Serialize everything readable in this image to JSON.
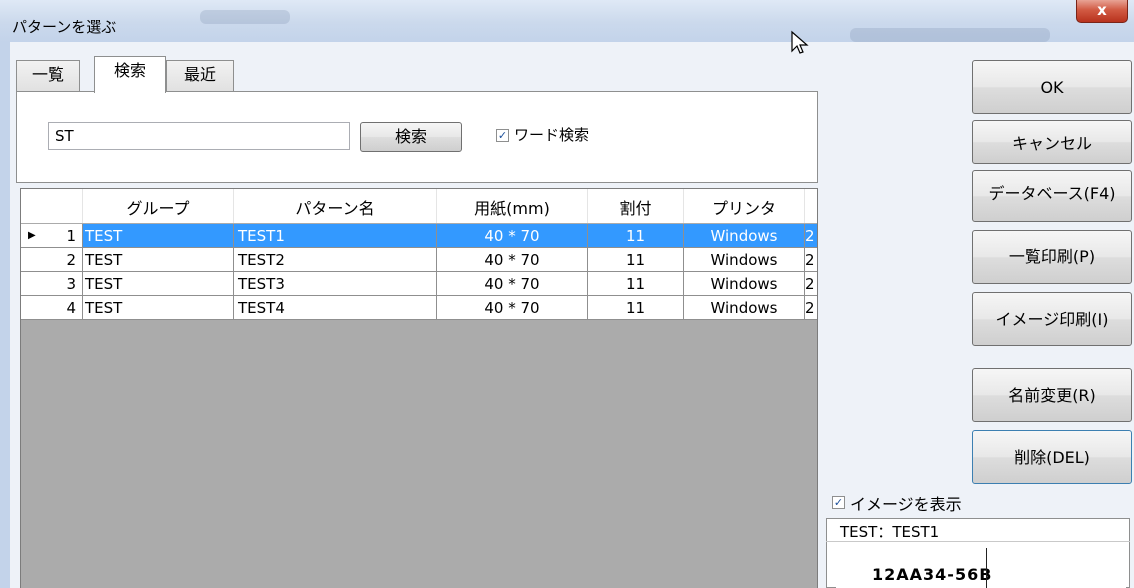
{
  "window": {
    "title": "パターンを選ぶ",
    "close_label": "x"
  },
  "tabs": [
    "一覧",
    "検索",
    "最近"
  ],
  "search": {
    "value": "ST",
    "button_label": "検索",
    "word_search_label": "ワード検索",
    "word_search_checked": true
  },
  "grid": {
    "columns": [
      "グループ",
      "パターン名",
      "用紙(mm)",
      "割付",
      "プリンタ"
    ],
    "rows": [
      {
        "num": "1",
        "group": "TEST",
        "name": "TEST1",
        "paper": "40 * 70",
        "layout": "11",
        "printer": "Windows",
        "extra": "2",
        "selected": true
      },
      {
        "num": "2",
        "group": "TEST",
        "name": "TEST2",
        "paper": "40 * 70",
        "layout": "11",
        "printer": "Windows",
        "extra": "2",
        "selected": false
      },
      {
        "num": "3",
        "group": "TEST",
        "name": "TEST3",
        "paper": "40 * 70",
        "layout": "11",
        "printer": "Windows",
        "extra": "2",
        "selected": false
      },
      {
        "num": "4",
        "group": "TEST",
        "name": "TEST4",
        "paper": "40 * 70",
        "layout": "11",
        "printer": "Windows",
        "extra": "2",
        "selected": false
      }
    ]
  },
  "buttons": {
    "ok": "OK",
    "cancel": "キャンセル",
    "database": "データベース(F4)",
    "list_print": "一覧印刷(P)",
    "image_print": "イメージ印刷(I)",
    "rename": "名前変更(R)",
    "delete": "削除(DEL)"
  },
  "preview": {
    "show_image_label": "イメージを表示",
    "show_image_checked": true,
    "title": "TEST：TEST1",
    "code": "12AA34-56B"
  },
  "colors": {
    "selection": "#3399ff",
    "grid_background": "#ababab",
    "titlebar": "#cbd9ec",
    "close_button": "#c8442c"
  }
}
